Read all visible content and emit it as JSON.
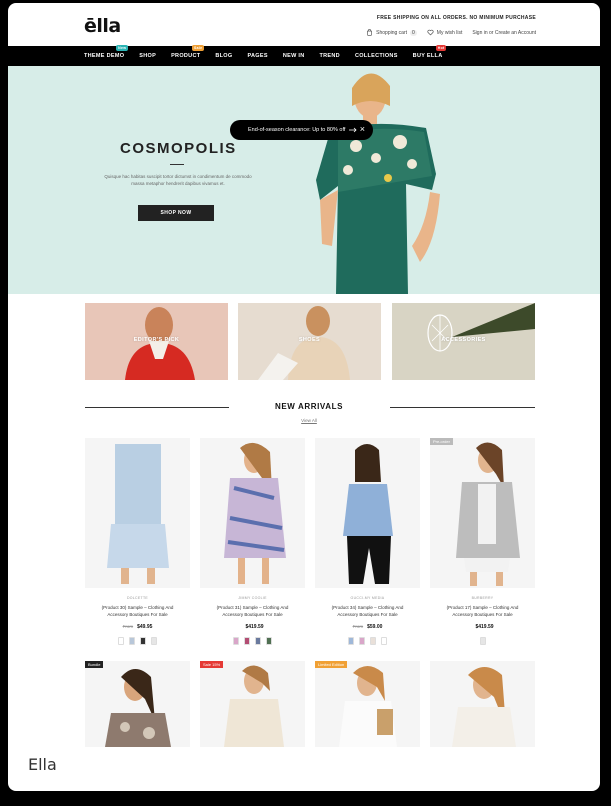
{
  "caption": "Ella",
  "header": {
    "logo": "ēlla",
    "promo": "FREE SHIPPING ON ALL ORDERS. NO MINIMUM PURCHASE",
    "shopping_cart_label": "Shopping cart",
    "cart_count": "0",
    "wishlist_label": "My wish list",
    "account_label": "Sign in or Create an Account"
  },
  "nav": {
    "items": [
      {
        "label": "THEME DEMO",
        "badge": "New",
        "badge_color": "#2bb5b5"
      },
      {
        "label": "SHOP",
        "badge": "",
        "badge_color": ""
      },
      {
        "label": "PRODUCT",
        "badge": "Sale",
        "badge_color": "#f0a035"
      },
      {
        "label": "BLOG",
        "badge": "",
        "badge_color": ""
      },
      {
        "label": "PAGES",
        "badge": "",
        "badge_color": ""
      },
      {
        "label": "NEW IN",
        "badge": "",
        "badge_color": ""
      },
      {
        "label": "TREND",
        "badge": "",
        "badge_color": ""
      },
      {
        "label": "COLLECTIONS",
        "badge": "",
        "badge_color": ""
      },
      {
        "label": "BUY ELLA",
        "badge": "Hot",
        "badge_color": "#e53935"
      }
    ]
  },
  "hero": {
    "title": "COSMOPOLIS",
    "description": "Quisque hac habitas suscipit tortor dictumst in condimentum de commodo massa metaphor hendrerit dapibus vivamus et.",
    "button": "SHOP NOW",
    "clearance": "End-of-season clearance: Up to 80% off"
  },
  "categories": [
    {
      "label": "EDITOR'S PICK",
      "bg": "#e8c6b8",
      "accent": "#d62a22"
    },
    {
      "label": "SHOES",
      "bg": "#e6dcd0",
      "accent": "#f2f0ec"
    },
    {
      "label": "ACCESSORIES",
      "bg": "#d8d4c4",
      "accent": "#3d4a2a"
    }
  ],
  "new_arrivals": {
    "title": "NEW ARRIVALS",
    "view_all": "View All"
  },
  "products": [
    {
      "vendor": "DOLCETTE",
      "title": "(Product 30) Sample – Clothing And Accessory Boutiques For Sale",
      "old_price": "From",
      "price": "$49.95",
      "badge": "",
      "badge_color": "",
      "swatches": [
        "#ffffff",
        "#b8c7d9",
        "#333333",
        "#e6e6e6"
      ]
    },
    {
      "vendor": "JIMMY COOLIE",
      "title": "(Product 31) Sample – Clothing And Accessory Boutiques For Sale",
      "old_price": "",
      "price": "$419.59",
      "badge": "",
      "badge_color": "",
      "swatches": [
        "#d9a6c9",
        "#b34d73",
        "#6a7a9e",
        "#507052"
      ]
    },
    {
      "vendor": "GUCCI-MY MEDIA",
      "title": "(Product 34) Sample – Clothing And Accessory Boutiques For Sale",
      "old_price": "From",
      "price": "$59.00",
      "badge": "",
      "badge_color": "",
      "swatches": [
        "#9fb8d9",
        "#d9a6c9",
        "#e9e0d9",
        "#ffffff"
      ]
    },
    {
      "vendor": "BURBERRY",
      "title": "(Product 17) Sample – Clothing And Accessory Boutiques For Sale",
      "old_price": "",
      "price": "$419.59",
      "badge": "Pre-order",
      "badge_color": "#bbbbbb",
      "swatches": [
        "#e6e6e6"
      ]
    }
  ],
  "products_row2": [
    {
      "badge": "Bundle",
      "badge_color": "#222222"
    },
    {
      "badge": "Sale 15%",
      "badge_color": "#e53935"
    },
    {
      "badge": "Limited Edition",
      "badge_color": "#f0a035"
    },
    {
      "badge": "",
      "badge_color": ""
    }
  ]
}
